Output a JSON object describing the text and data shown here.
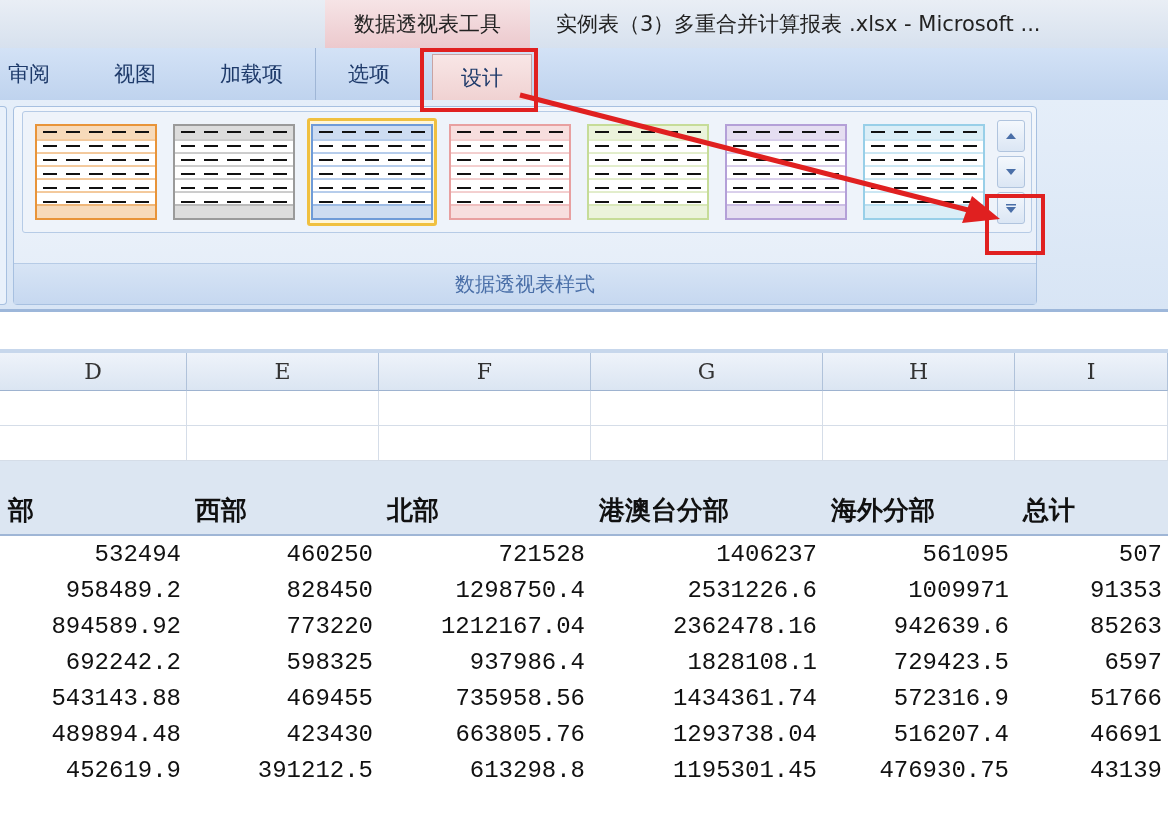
{
  "title_bar": {
    "contextual_tab": "数据透视表工具",
    "title": "实例表（3）多重合并计算报表 .xlsx - Microsoft ..."
  },
  "tabs": [
    {
      "label": "审阅",
      "selected": false
    },
    {
      "label": "视图",
      "selected": false
    },
    {
      "label": "加载项",
      "selected": false
    },
    {
      "label": "选项",
      "selected": false,
      "group_start": true
    },
    {
      "label": "设计",
      "selected": true
    }
  ],
  "styles_gallery": {
    "styles": [
      {
        "color": "#e8943a",
        "selected": false
      },
      {
        "color": "#9a9a9a",
        "selected": false
      },
      {
        "color": "#6f9bd8",
        "selected": true
      },
      {
        "color": "#e8a0a0",
        "selected": false
      },
      {
        "color": "#c6dc98",
        "selected": false
      },
      {
        "color": "#b4a0d8",
        "selected": false
      },
      {
        "color": "#98cfe8",
        "selected": false
      }
    ],
    "group_label": "数据透视表样式"
  },
  "sheet": {
    "columns": [
      "D",
      "E",
      "F",
      "G",
      "H",
      "I"
    ],
    "pivot_headers": [
      "部",
      "西部",
      "北部",
      "港澳台分部",
      "海外分部",
      "总计"
    ],
    "rows": [
      [
        "532494",
        "460250",
        "721528",
        "1406237",
        "561095",
        "507"
      ],
      [
        "958489.2",
        "828450",
        "1298750.4",
        "2531226.6",
        "1009971",
        "91353"
      ],
      [
        "894589.92",
        "773220",
        "1212167.04",
        "2362478.16",
        "942639.6",
        "85263"
      ],
      [
        "692242.2",
        "598325",
        "937986.4",
        "1828108.1",
        "729423.5",
        "6597"
      ],
      [
        "543143.88",
        "469455",
        "735958.56",
        "1434361.74",
        "572316.9",
        "51766"
      ],
      [
        "489894.48",
        "423430",
        "663805.76",
        "1293738.04",
        "516207.4",
        "46691"
      ],
      [
        "452619.9",
        "391212.5",
        "613298.8",
        "1195301.45",
        "476930.75",
        "43139"
      ]
    ]
  }
}
